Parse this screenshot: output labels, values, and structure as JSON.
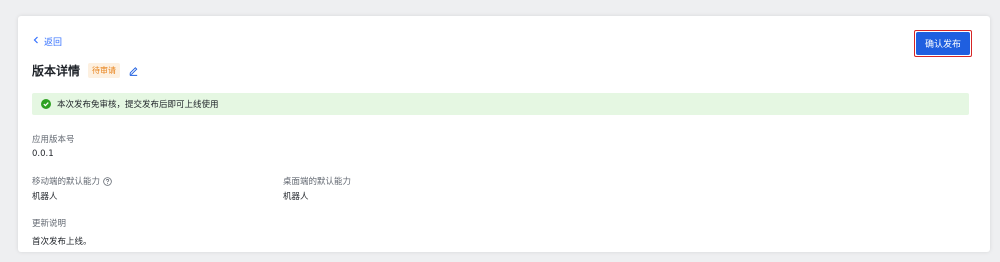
{
  "header": {
    "back_label": "返回",
    "confirm_label": "确认发布"
  },
  "title": {
    "text": "版本详情",
    "status": "待审请"
  },
  "notice": {
    "text": "本次发布免审核，提交发布后即可上线使用"
  },
  "fields": {
    "version_label": "应用版本号",
    "version_value": "0.0.1",
    "mobile_label": "移动端的默认能力",
    "mobile_value": "机器人",
    "desktop_label": "桌面端的默认能力",
    "desktop_value": "机器人",
    "notes_label": "更新说明",
    "notes_value": "首次发布上线。"
  },
  "colors": {
    "accent": "#3370ff",
    "confirm_button": "#1f5fe0",
    "highlight_border": "#d62525",
    "status_text": "#e8821a",
    "status_bg": "#fdf0e0",
    "notice_bg": "#e5f7e2",
    "success_icon": "#2ea121"
  },
  "icons": {
    "back": "chevron-left-icon",
    "edit": "pencil-icon",
    "notice": "check-circle-icon",
    "help": "question-circle-icon"
  }
}
